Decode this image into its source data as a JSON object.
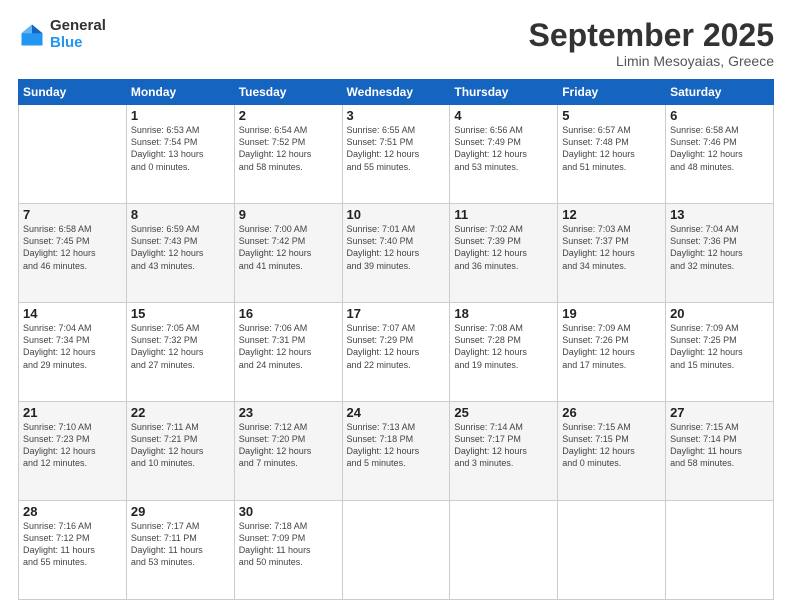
{
  "logo": {
    "general": "General",
    "blue": "Blue"
  },
  "header": {
    "month": "September 2025",
    "location": "Limin Mesoyaias, Greece"
  },
  "weekdays": [
    "Sunday",
    "Monday",
    "Tuesday",
    "Wednesday",
    "Thursday",
    "Friday",
    "Saturday"
  ],
  "weeks": [
    [
      {
        "day": "",
        "info": ""
      },
      {
        "day": "1",
        "info": "Sunrise: 6:53 AM\nSunset: 7:54 PM\nDaylight: 13 hours\nand 0 minutes."
      },
      {
        "day": "2",
        "info": "Sunrise: 6:54 AM\nSunset: 7:52 PM\nDaylight: 12 hours\nand 58 minutes."
      },
      {
        "day": "3",
        "info": "Sunrise: 6:55 AM\nSunset: 7:51 PM\nDaylight: 12 hours\nand 55 minutes."
      },
      {
        "day": "4",
        "info": "Sunrise: 6:56 AM\nSunset: 7:49 PM\nDaylight: 12 hours\nand 53 minutes."
      },
      {
        "day": "5",
        "info": "Sunrise: 6:57 AM\nSunset: 7:48 PM\nDaylight: 12 hours\nand 51 minutes."
      },
      {
        "day": "6",
        "info": "Sunrise: 6:58 AM\nSunset: 7:46 PM\nDaylight: 12 hours\nand 48 minutes."
      }
    ],
    [
      {
        "day": "7",
        "info": "Sunrise: 6:58 AM\nSunset: 7:45 PM\nDaylight: 12 hours\nand 46 minutes."
      },
      {
        "day": "8",
        "info": "Sunrise: 6:59 AM\nSunset: 7:43 PM\nDaylight: 12 hours\nand 43 minutes."
      },
      {
        "day": "9",
        "info": "Sunrise: 7:00 AM\nSunset: 7:42 PM\nDaylight: 12 hours\nand 41 minutes."
      },
      {
        "day": "10",
        "info": "Sunrise: 7:01 AM\nSunset: 7:40 PM\nDaylight: 12 hours\nand 39 minutes."
      },
      {
        "day": "11",
        "info": "Sunrise: 7:02 AM\nSunset: 7:39 PM\nDaylight: 12 hours\nand 36 minutes."
      },
      {
        "day": "12",
        "info": "Sunrise: 7:03 AM\nSunset: 7:37 PM\nDaylight: 12 hours\nand 34 minutes."
      },
      {
        "day": "13",
        "info": "Sunrise: 7:04 AM\nSunset: 7:36 PM\nDaylight: 12 hours\nand 32 minutes."
      }
    ],
    [
      {
        "day": "14",
        "info": "Sunrise: 7:04 AM\nSunset: 7:34 PM\nDaylight: 12 hours\nand 29 minutes."
      },
      {
        "day": "15",
        "info": "Sunrise: 7:05 AM\nSunset: 7:32 PM\nDaylight: 12 hours\nand 27 minutes."
      },
      {
        "day": "16",
        "info": "Sunrise: 7:06 AM\nSunset: 7:31 PM\nDaylight: 12 hours\nand 24 minutes."
      },
      {
        "day": "17",
        "info": "Sunrise: 7:07 AM\nSunset: 7:29 PM\nDaylight: 12 hours\nand 22 minutes."
      },
      {
        "day": "18",
        "info": "Sunrise: 7:08 AM\nSunset: 7:28 PM\nDaylight: 12 hours\nand 19 minutes."
      },
      {
        "day": "19",
        "info": "Sunrise: 7:09 AM\nSunset: 7:26 PM\nDaylight: 12 hours\nand 17 minutes."
      },
      {
        "day": "20",
        "info": "Sunrise: 7:09 AM\nSunset: 7:25 PM\nDaylight: 12 hours\nand 15 minutes."
      }
    ],
    [
      {
        "day": "21",
        "info": "Sunrise: 7:10 AM\nSunset: 7:23 PM\nDaylight: 12 hours\nand 12 minutes."
      },
      {
        "day": "22",
        "info": "Sunrise: 7:11 AM\nSunset: 7:21 PM\nDaylight: 12 hours\nand 10 minutes."
      },
      {
        "day": "23",
        "info": "Sunrise: 7:12 AM\nSunset: 7:20 PM\nDaylight: 12 hours\nand 7 minutes."
      },
      {
        "day": "24",
        "info": "Sunrise: 7:13 AM\nSunset: 7:18 PM\nDaylight: 12 hours\nand 5 minutes."
      },
      {
        "day": "25",
        "info": "Sunrise: 7:14 AM\nSunset: 7:17 PM\nDaylight: 12 hours\nand 3 minutes."
      },
      {
        "day": "26",
        "info": "Sunrise: 7:15 AM\nSunset: 7:15 PM\nDaylight: 12 hours\nand 0 minutes."
      },
      {
        "day": "27",
        "info": "Sunrise: 7:15 AM\nSunset: 7:14 PM\nDaylight: 11 hours\nand 58 minutes."
      }
    ],
    [
      {
        "day": "28",
        "info": "Sunrise: 7:16 AM\nSunset: 7:12 PM\nDaylight: 11 hours\nand 55 minutes."
      },
      {
        "day": "29",
        "info": "Sunrise: 7:17 AM\nSunset: 7:11 PM\nDaylight: 11 hours\nand 53 minutes."
      },
      {
        "day": "30",
        "info": "Sunrise: 7:18 AM\nSunset: 7:09 PM\nDaylight: 11 hours\nand 50 minutes."
      },
      {
        "day": "",
        "info": ""
      },
      {
        "day": "",
        "info": ""
      },
      {
        "day": "",
        "info": ""
      },
      {
        "day": "",
        "info": ""
      }
    ]
  ]
}
